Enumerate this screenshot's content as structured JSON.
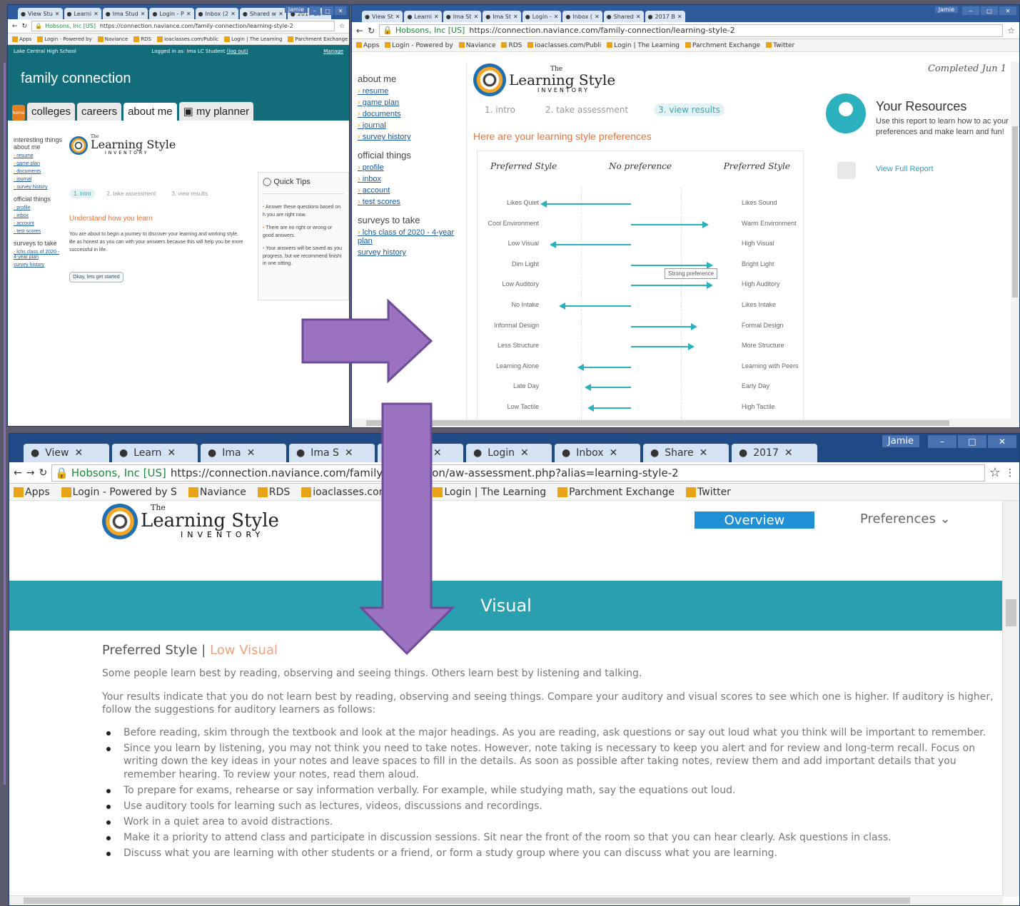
{
  "win1": {
    "tabs": [
      "View Stu",
      "Learni",
      "Ima Stud",
      "Login - P",
      "Inbox (2",
      "Shared w",
      "2017 Bo"
    ],
    "user": "Jamie",
    "url_host": "Hobsons, Inc [US]",
    "url": "https://connection.naviance.com/family-connection/learning-style-2",
    "bookmarks": [
      "Apps",
      "Login - Powered by",
      "Naviance",
      "RDS",
      "ioaclasses.com/Public",
      "Login | The Learning",
      "Parchment Exchange",
      "Twitter"
    ],
    "school": "Lake Central High School",
    "logged_in": "Logged in as: Ima LC Student",
    "logout": "(log out)",
    "manage": "Manage",
    "app_title": "family connection",
    "home": "home",
    "nav": [
      "colleges",
      "careers",
      "about me",
      "my planner"
    ],
    "side_heading1": "interesting things about me",
    "side_links1": [
      "resume",
      "game plan",
      "documents",
      "journal",
      "survey history"
    ],
    "side_heading2": "official things",
    "side_links2": [
      "profile",
      "inbox",
      "account",
      "test scores"
    ],
    "side_heading3": "surveys to take",
    "side_links3": [
      "lchs class of 2020 - 4-year plan"
    ],
    "survey_history": "survey history",
    "logo_the": "The",
    "logo_title": "Learning Style",
    "logo_sub": "INVENTORY",
    "steps": [
      "1. intro",
      "2. take assessment",
      "3. view results"
    ],
    "subtitle": "Understand how you learn",
    "intro": "You are about to begin a journey to discover your learning and working style. Be as honest as you can with your answers because this will help you be more successful in life.",
    "start_btn": "Okay, lets get started",
    "tips_title": "Quick Tips",
    "tips": [
      "Answer these questions based on h you are right now.",
      "There are no right or wrong or good answers.",
      "Your answers will be saved as you progress, but we recommend finishi in one sitting."
    ]
  },
  "win2": {
    "tabs": [
      "View St",
      "Learni",
      "Ima St",
      "Ima St",
      "Login -",
      "Inbox (",
      "Shared",
      "2017 B"
    ],
    "user": "Jamie",
    "url_host": "Hobsons, Inc [US]",
    "url": "https://connection.naviance.com/family-connection/learning-style-2",
    "bookmarks": [
      "Apps",
      "Login - Powered by",
      "Naviance",
      "RDS",
      "ioaclasses.com/Publi",
      "Login | The Learning",
      "Parchment Exchange",
      "Twitter"
    ],
    "side_heading_partial": "about me",
    "side_links1": [
      "resume",
      "game plan",
      "documents",
      "journal",
      "survey history"
    ],
    "side_heading2": "official things",
    "side_links2": [
      "profile",
      "inbox",
      "account",
      "test scores"
    ],
    "side_heading3": "surveys to take",
    "side_links3": [
      "lchs class of 2020 - 4-year plan"
    ],
    "survey_history": "survey history",
    "logo_the": "The",
    "logo_title": "Learning Style",
    "logo_sub": "INVENTORY",
    "completed": "Completed Jun 1",
    "steps": [
      "1. intro",
      "2. take assessment",
      "3. view results"
    ],
    "results_heading": "Here are your learning style preferences",
    "col_left": "Preferred Style",
    "col_mid": "No preference",
    "col_right": "Preferred Style",
    "strong_pref": "Strong preference",
    "res_title": "Your Resources",
    "res_text": "Use this report to learn how to ac your preferences and make learn and fun!",
    "res_link": "View Full Report"
  },
  "chart_data": {
    "type": "bar",
    "scale": "-1 = strong left preference, 0 = no preference, +1 = strong right preference",
    "rows": [
      {
        "left": "Likes Quiet",
        "right": "Likes Sound",
        "value": -0.95
      },
      {
        "left": "Cool Environment",
        "right": "Warm Environment",
        "value": 0.8
      },
      {
        "left": "Low Visual",
        "right": "High Visual",
        "value": -0.85
      },
      {
        "left": "Dim Light",
        "right": "Bright Light",
        "value": 0.85
      },
      {
        "left": "Low Auditory",
        "right": "High Auditory",
        "value": 0.85
      },
      {
        "left": "No Intake",
        "right": "Likes Intake",
        "value": -0.75
      },
      {
        "left": "Informal Design",
        "right": "Formal Design",
        "value": 0.68
      },
      {
        "left": "Less Structure",
        "right": "More Structure",
        "value": 0.65
      },
      {
        "left": "Learning Alone",
        "right": "Learning with Peers",
        "value": -0.55
      },
      {
        "left": "Late Day",
        "right": "Early Day",
        "value": -0.48
      },
      {
        "left": "Low Tactile",
        "right": "High Tactile",
        "value": -0.45
      }
    ]
  },
  "win3": {
    "tabs": [
      "View",
      "Learn",
      "Ima",
      "Ima S",
      "Ima S",
      "Login",
      "Inbox",
      "Share",
      "2017"
    ],
    "user": "Jamie",
    "url_host": "Hobsons, Inc [US]",
    "url": "https://connection.naviance.com/family-connection/aw-assessment.php?alias=learning-style-2",
    "bookmarks": [
      "Apps",
      "Login - Powered by S",
      "Naviance",
      "RDS",
      "ioaclasses.com/Public",
      "Login | The Learning",
      "Parchment Exchange",
      "Twitter"
    ],
    "logo_the": "The",
    "logo_title": "Learning Style",
    "logo_sub": "INVENTORY",
    "overview": "Overview",
    "preferences": "Preferences ⌄",
    "band_title": "Visual",
    "pref_label": "Preferred Style",
    "pref_value": "Low Visual",
    "p1": "Some people learn best by reading, observing and seeing things. Others learn best by listening and talking.",
    "p2": "Your results indicate that you do not learn best by reading, observing and seeing things. Compare your auditory and visual scores to see which one is higher. If auditory is higher, follow the suggestions for auditory learners as follows:",
    "bullets": [
      "Before reading, skim through the textbook and look at the major headings. As you are reading, ask questions or say out loud what you think will be important to remember.",
      "Since you learn by listening, you may not think you need to take notes. However, note taking is necessary to keep you alert and for review and long-term recall. Focus on writing down the key ideas in your notes and leave spaces to fill in the details. As soon as possible after taking notes, review them and add important details that you remember hearing. To review your notes, read them aloud.",
      "To prepare for exams, rehearse or say information verbally. For example, while studying math, say the equations out loud.",
      "Use auditory tools for learning such as lectures, videos, discussions and recordings.",
      "Work in a quiet area to avoid distractions.",
      "Make it a priority to attend class and participate in discussion sessions. Sit near the front of the room so that you can hear clearly. Ask questions in class.",
      "Discuss what you are learning with other students or a friend, or form a study group where you can discuss what you are learning."
    ]
  },
  "colors": {
    "teal": "#136c7a",
    "bar": "#2bb0be",
    "arrow": "#9b72c0",
    "accent_orange": "#e8743b",
    "overview_btn": "#1f8fd6"
  }
}
